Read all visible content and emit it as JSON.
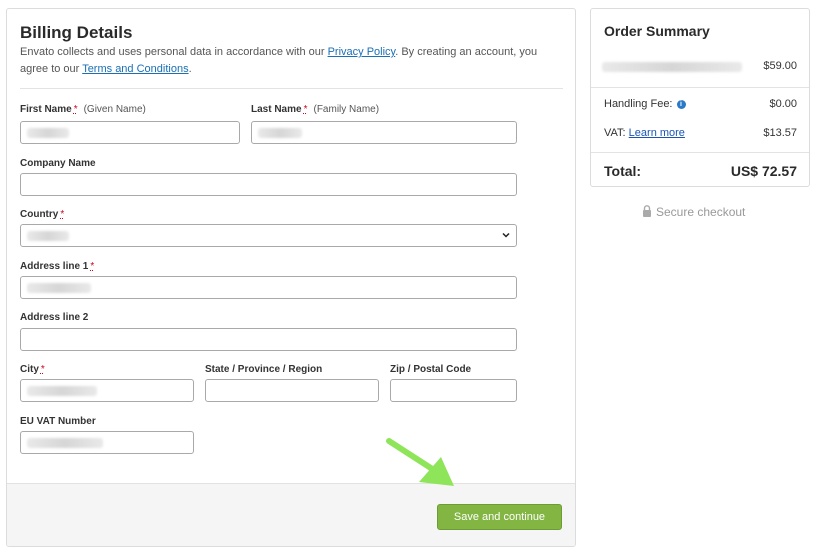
{
  "billing": {
    "title": "Billing Details",
    "intro_prefix": "Envato collects and uses personal data in accordance with our ",
    "privacy_link": "Privacy Policy",
    "intro_middle": ". By creating an account, you agree to our ",
    "terms_link": "Terms and Conditions",
    "intro_suffix": ".",
    "fields": {
      "first_name": {
        "label": "First Name",
        "required": "*",
        "hint": "(Given Name)",
        "value": ""
      },
      "last_name": {
        "label": "Last Name",
        "required": "*",
        "hint": "(Family Name)",
        "value": ""
      },
      "company": {
        "label": "Company Name",
        "value": ""
      },
      "country": {
        "label": "Country",
        "required": "*",
        "value": ""
      },
      "address1": {
        "label": "Address line 1",
        "required": "*",
        "value": ""
      },
      "address2": {
        "label": "Address line 2",
        "value": ""
      },
      "city": {
        "label": "City",
        "required": "*",
        "value": ""
      },
      "state": {
        "label": "State / Province / Region",
        "value": ""
      },
      "zip": {
        "label": "Zip / Postal Code",
        "value": ""
      },
      "vat": {
        "label": "EU VAT Number",
        "value": ""
      }
    },
    "save_label": "Save and continue",
    "save_color": "#82b541",
    "arrow_color": "#8ee55a"
  },
  "summary": {
    "title": "Order Summary",
    "item_price": "$59.00",
    "handling_label": "Handling Fee:",
    "handling_value": "$0.00",
    "vat_label": "VAT:",
    "vat_link": "Learn more",
    "vat_value": "$13.57",
    "total_label": "Total:",
    "total_value": "US$ 72.57"
  },
  "secure_label": "Secure checkout",
  "icons": [
    "info-icon",
    "lock-icon",
    "chevron-down-icon",
    "arrow-pointer-icon"
  ]
}
